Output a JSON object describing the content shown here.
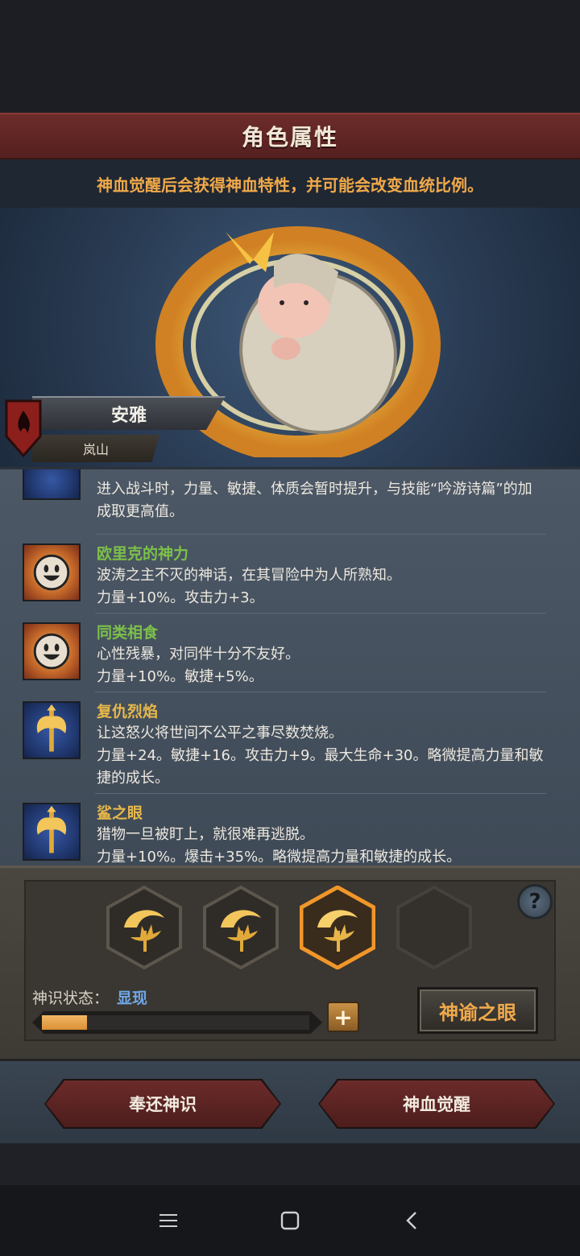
{
  "header": {
    "title": "角色属性",
    "subtitle": "神血觉醒后会获得神血特性，并可能会改变血统比例。"
  },
  "character": {
    "name": "安雅",
    "origin": "岚山"
  },
  "traits": [
    {
      "name": "",
      "name_color": "#7cc04a",
      "icon": "golden-axe-icon",
      "lines": [
        "进入战斗时，力量、敏捷、体质会暂时提升，与技能“吟游诗篇”的加",
        "成取更高值。"
      ]
    },
    {
      "name": "欧里克的神力",
      "name_color": "#7cc04a",
      "icon": "smiley-sun-icon",
      "lines": [
        "波涛之主不灭的神话，在其冒险中为人所熟知。",
        "力量+10%。攻击力+3。"
      ]
    },
    {
      "name": "同类相食",
      "name_color": "#7cc04a",
      "icon": "smiley-sun-icon",
      "lines": [
        "心性残暴，对同伴十分不友好。",
        "力量+10%。敏捷+5%。"
      ]
    },
    {
      "name": "复仇烈焰",
      "name_color": "#e6b84a",
      "icon": "golden-axe-icon",
      "lines": [
        "让这怒火将世间不公平之事尽数焚烧。",
        "力量+24。敏捷+16。攻击力+9。最大生命+30。略微提高力量和敏",
        "捷的成长。"
      ]
    },
    {
      "name": "鲨之眼",
      "name_color": "#e6b84a",
      "icon": "golden-axe-icon",
      "lines": [
        "猎物一旦被盯上，就很难再逃脱。",
        "力量+10%。爆击+35%。略微提高力量和敏捷的成长。"
      ]
    }
  ],
  "divine_sense": {
    "slots": [
      "golden-trident-emblem",
      "golden-trident-emblem",
      "golden-trident-emblem-selected",
      "empty-slot"
    ],
    "state_label": "神识状态：",
    "state_value": "显现",
    "progress": 0.17,
    "plus_label": "+",
    "help_label": "?",
    "oracle_button": "神谕之眼"
  },
  "actions": {
    "return_button": "奉还神识",
    "awaken_button": "神血觉醒"
  },
  "colors": {
    "title_bar": "#6d2c2b",
    "accent_orange": "#f0a94a",
    "state_blue": "#6fa8e8"
  }
}
